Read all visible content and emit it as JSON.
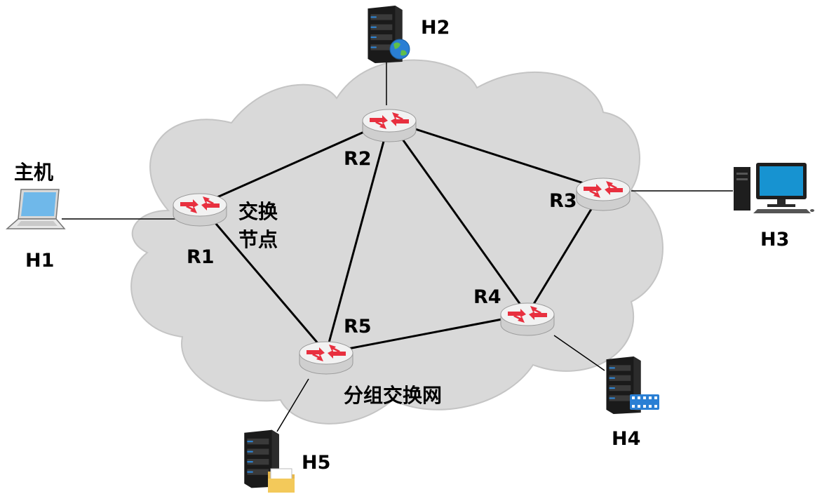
{
  "labels": {
    "host_title": "主机",
    "h1": "H1",
    "h2": "H2",
    "h3": "H3",
    "h4": "H4",
    "h5": "H5",
    "r1": "R1",
    "r2": "R2",
    "r3": "R3",
    "r4": "R4",
    "r5": "R5",
    "switch_node_line1": "交换",
    "switch_node_line2": "节点",
    "network": "分组交换网"
  },
  "colors": {
    "cloud_fill": "#d9d9d9",
    "cloud_stroke": "#bfbfbf",
    "link": "#000000",
    "router_body": "#e6e6e6",
    "router_arrow": "#e8303f",
    "server_body": "#1f1f1f",
    "server_stripe": "#2f86d6"
  },
  "icons": {
    "router": "router-icon",
    "laptop": "laptop-icon",
    "desktop": "desktop-computer-icon",
    "web_server": "web-server-icon",
    "video_server": "video-server-icon",
    "file_server": "file-server-icon"
  }
}
